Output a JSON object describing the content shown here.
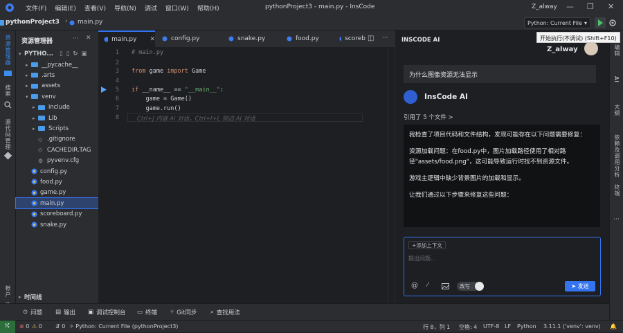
{
  "titlebar": {
    "menu": [
      "文件(F)",
      "编辑(E)",
      "查看(V)",
      "导航(N)",
      "调试",
      "窗口(W)",
      "帮助(H)"
    ],
    "window_title": "pythonProject3 - main.py - InsCode",
    "user": "Z_alway"
  },
  "breadcrumb": {
    "project": "pythonProject3",
    "file": "main.py"
  },
  "run": {
    "config": "Python: Current File",
    "tooltip": "开始执行(不调试) (Shift+F10)"
  },
  "activity": {
    "explorer": "资源管理器",
    "search": "搜索",
    "scm": "源代码管理",
    "extensions": "扩展",
    "accounts": "帐户"
  },
  "explorer": {
    "title": "资源管理器",
    "root": "PYTHO...",
    "items": [
      {
        "label": "__pycache__",
        "kind": "folder",
        "level": 1,
        "open": false
      },
      {
        "label": ".arts",
        "kind": "folder",
        "level": 1,
        "open": false
      },
      {
        "label": "assets",
        "kind": "folder",
        "level": 1,
        "open": false
      },
      {
        "label": "venv",
        "kind": "folder",
        "level": 1,
        "open": true
      },
      {
        "label": "include",
        "kind": "folder",
        "level": 2,
        "open": false
      },
      {
        "label": "Lib",
        "kind": "folder",
        "level": 2,
        "open": false
      },
      {
        "label": "Scripts",
        "kind": "folder",
        "level": 2,
        "open": false
      },
      {
        "label": ".gitignore",
        "kind": "file",
        "level": 2
      },
      {
        "label": "CACHEDIR.TAG",
        "kind": "file",
        "level": 2
      },
      {
        "label": "pyvenv.cfg",
        "kind": "cfg",
        "level": 2
      },
      {
        "label": "config.py",
        "kind": "py",
        "level": 1
      },
      {
        "label": "food.py",
        "kind": "py",
        "level": 1
      },
      {
        "label": "game.py",
        "kind": "py",
        "level": 1
      },
      {
        "label": "main.py",
        "kind": "py",
        "level": 1,
        "selected": true
      },
      {
        "label": "scoreboard.py",
        "kind": "py",
        "level": 1
      },
      {
        "label": "snake.py",
        "kind": "py",
        "level": 1
      }
    ],
    "timeline": "时间线"
  },
  "tabs": [
    "main.py",
    "config.py",
    "snake.py",
    "food.py",
    "scoreb"
  ],
  "code": {
    "lines": [
      "1",
      "2",
      "3",
      "4",
      "5",
      "6",
      "7",
      "8"
    ],
    "comment": "# main.py",
    "from_kw": "from",
    "import_line": " game ",
    "import_kw": "import",
    "import_name": " Game",
    "if_kw": "if",
    "if_rest": " __name__ == ",
    "if_str": "\"__main__\"",
    "if_colon": ":",
    "l6": "    game = Game()",
    "l7": "    game.run()",
    "hint": "Ctrl+J 内嵌 AI 对话，Ctrl+I+L 侧边 AI 对话"
  },
  "ai": {
    "title": "INSCODE AI",
    "user": "Z_alway",
    "question": "为什么图像资源无法显示",
    "bot": "InsCode AI",
    "refs": "引用了 5 个文件 >",
    "answer": [
      "我检查了项目代码和文件结构，发现可能存在以下问题需要修复：",
      "资源加载问题：在food.py中，图片加载路径使用了相对路径\"assets/food.png\"，这可能导致运行时找不到资源文件。",
      "游戏主逻辑中缺少背景图片的加载和显示。",
      "让我们通过以下步骤来修复这些问题："
    ],
    "add_context": "+添加上下文",
    "placeholder": "提出问题...",
    "mode": "改写",
    "send": "发送"
  },
  "rail": [
    "编辑",
    "AI",
    "大纲",
    "依赖及调用分析",
    "终端"
  ],
  "bottom_tools": [
    "问题",
    "输出",
    "调试控制台",
    "终端",
    "Git同步",
    "查找用法"
  ],
  "status": {
    "errors": "0",
    "warnings": "0",
    "ports": "0",
    "config": "Python: Current File (pythonProject3)",
    "position": "行 8，列 1",
    "spaces": "空格: 4",
    "encoding": "UTF-8",
    "eol": "LF",
    "lang": "Python",
    "interpreter": "3.11.1 ('venv': venv)"
  }
}
